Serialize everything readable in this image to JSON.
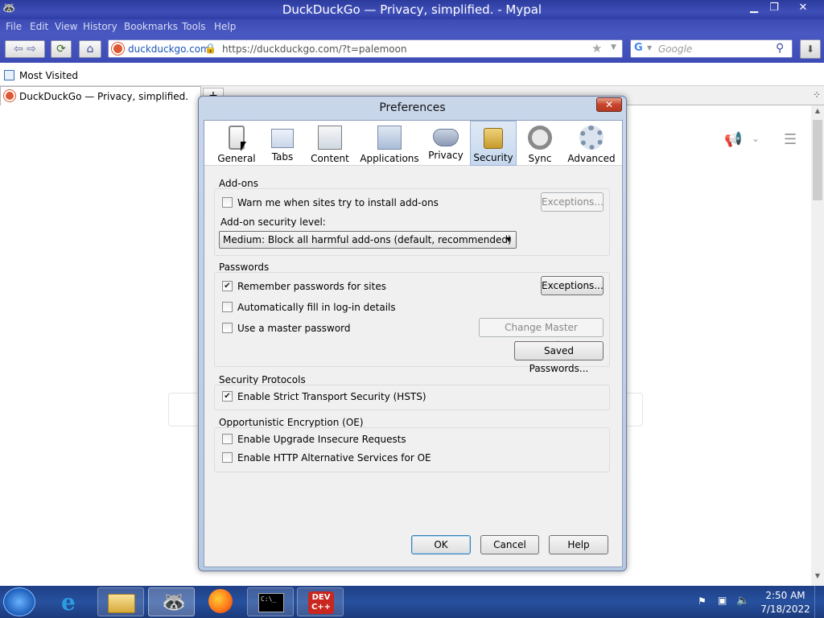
{
  "window": {
    "title": "DuckDuckGo — Privacy, simplified. - Mypal"
  },
  "menu": [
    "File",
    "Edit",
    "View",
    "History",
    "Bookmarks",
    "Tools",
    "Help"
  ],
  "nav": {
    "site_label": "duckduckgo.com",
    "url": "https://duckduckgo.com/?t=palemoon",
    "search_placeholder": "Google"
  },
  "bookmarks": {
    "most_visited": "Most Visited"
  },
  "tab": {
    "title": "DuckDuckGo — Privacy, simplified.",
    "new_tab": "+"
  },
  "dialog": {
    "title": "Preferences",
    "close": "✕",
    "toolbar": [
      {
        "label": "General",
        "icon": "switch-icon"
      },
      {
        "label": "Tabs",
        "icon": "tabs-icon"
      },
      {
        "label": "Content",
        "icon": "content-icon"
      },
      {
        "label": "Applications",
        "icon": "applications-icon"
      },
      {
        "label": "Privacy",
        "icon": "mask-icon"
      },
      {
        "label": "Security",
        "icon": "padlock-icon",
        "selected": true
      },
      {
        "label": "Sync",
        "icon": "sync-icon"
      },
      {
        "label": "Advanced",
        "icon": "gear-icon"
      }
    ],
    "addons": {
      "header": "Add-ons",
      "warn_label": "Warn me when sites try to install add-ons",
      "warn_checked": false,
      "exceptions": "Exceptions...",
      "level_label": "Add-on security level:",
      "level_value": "Medium: Block all harmful add-ons (default, recommended)"
    },
    "passwords": {
      "header": "Passwords",
      "remember_label": "Remember passwords for sites",
      "remember_checked": true,
      "autofill_label": "Automatically fill in log-in details",
      "master_label": "Use a master password",
      "exceptions": "Exceptions...",
      "change_master": "Change Master Password...",
      "saved": "Saved Passwords..."
    },
    "protocols": {
      "header": "Security Protocols",
      "hsts_label": "Enable Strict Transport Security (HSTS)",
      "hsts_checked": true
    },
    "oe": {
      "header": "Opportunistic Encryption (OE)",
      "upgrade_label": "Enable Upgrade Insecure Requests",
      "alt_label": "Enable HTTP Alternative Services for OE"
    },
    "buttons": {
      "ok": "OK",
      "cancel": "Cancel",
      "help": "Help"
    }
  },
  "taskbar": {
    "time": "2:50 AM",
    "date": "7/18/2022",
    "devcpp_label": "DEV C++"
  }
}
